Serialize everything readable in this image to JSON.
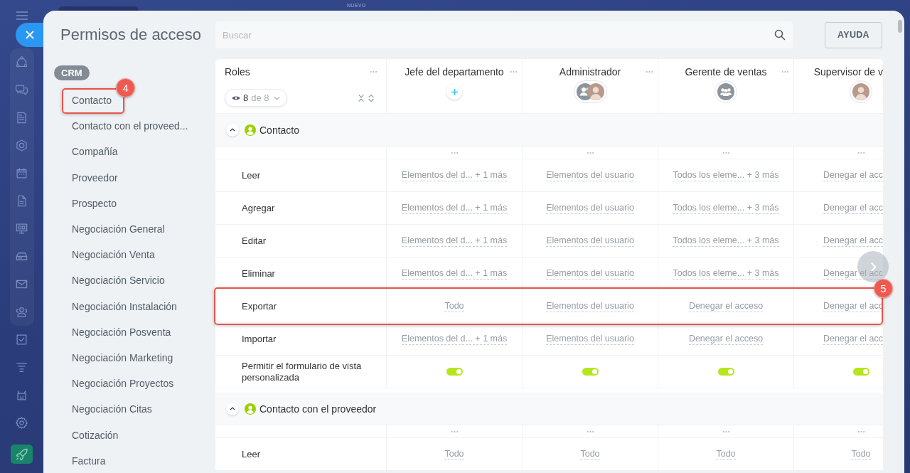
{
  "top_bar": {
    "badge": "NUEVO"
  },
  "panel": {
    "title": "Permisos de acceso",
    "search": {
      "placeholder": "Buscar"
    },
    "help_button": "AYUDA"
  },
  "nav": {
    "group": "CRM",
    "items": [
      {
        "label": "Contacto",
        "callout": "4"
      },
      {
        "label": "Contacto con el proveed..."
      },
      {
        "label": "Compañía"
      },
      {
        "label": "Proveedor"
      },
      {
        "label": "Prospecto"
      },
      {
        "label": "Negociación General"
      },
      {
        "label": "Negociación Venta"
      },
      {
        "label": "Negociación Servicio"
      },
      {
        "label": "Negociación Instalación"
      },
      {
        "label": "Negociación Posventa"
      },
      {
        "label": "Negociación Marketing"
      },
      {
        "label": "Negociación Proyectos"
      },
      {
        "label": "Negociación Citas"
      },
      {
        "label": "Cotización"
      },
      {
        "label": "Factura"
      }
    ]
  },
  "table": {
    "roles_header": "Roles",
    "filter": {
      "shown": "8",
      "total": "de 8"
    },
    "roles": [
      {
        "name": "Jefe del departamento",
        "members": [
          {
            "kind": "add"
          }
        ]
      },
      {
        "name": "Administrador",
        "members": [
          {
            "kind": "group"
          },
          {
            "kind": "user"
          }
        ]
      },
      {
        "name": "Gerente de ventas",
        "members": [
          {
            "kind": "department"
          }
        ]
      },
      {
        "name": "Supervisor de v",
        "members": [
          {
            "kind": "user"
          }
        ]
      }
    ],
    "sections": [
      {
        "title": "Contacto",
        "expanded": true,
        "rows": [
          {
            "label": "Leer",
            "kind": "select",
            "cells": [
              {
                "value": "Elementos del d... + 1 más"
              },
              {
                "value": "Elementos del usuario"
              },
              {
                "value": "Todos los eleme... + 3 más"
              },
              {
                "value": "Denegar el acc"
              }
            ]
          },
          {
            "label": "Agregar",
            "kind": "select",
            "cells": [
              {
                "value": "Elementos del d... + 1 más"
              },
              {
                "value": "Elementos del usuario"
              },
              {
                "value": "Todos los eleme... + 3 más"
              },
              {
                "value": "Denegar el acc"
              }
            ]
          },
          {
            "label": "Editar",
            "kind": "select",
            "cells": [
              {
                "value": "Elementos del d... + 1 más"
              },
              {
                "value": "Elementos del usuario"
              },
              {
                "value": "Todos los eleme... + 3 más"
              },
              {
                "value": "Denegar el acc"
              }
            ]
          },
          {
            "label": "Eliminar",
            "kind": "select",
            "cells": [
              {
                "value": "Elementos del d... + 1 más"
              },
              {
                "value": "Elementos del usuario"
              },
              {
                "value": "Todos los eleme... + 3 más"
              },
              {
                "value": "Denegar el acc"
              }
            ]
          },
          {
            "label": "Exportar",
            "kind": "select",
            "callout": "5",
            "cells": [
              {
                "value": "Todo"
              },
              {
                "value": "Elementos del usuario"
              },
              {
                "value": "Denegar el acceso"
              },
              {
                "value": "Denegar el acc"
              }
            ]
          },
          {
            "label": "Importar",
            "kind": "select",
            "cells": [
              {
                "value": "Elementos del d... + 1 más"
              },
              {
                "value": "Elementos del usuario"
              },
              {
                "value": "Denegar el acceso"
              },
              {
                "value": "Denegar el acc"
              }
            ]
          },
          {
            "label": "Permitir el formulario de vista personalizada",
            "kind": "toggle",
            "cells": [
              {
                "on": true
              },
              {
                "on": true
              },
              {
                "on": true
              },
              {
                "on": true
              }
            ]
          }
        ]
      },
      {
        "title": "Contacto con el proveedor",
        "expanded": true,
        "rows": [
          {
            "label": "Leer",
            "kind": "select",
            "cells": [
              {
                "value": "Todo"
              },
              {
                "value": "Todo"
              },
              {
                "value": "Todo"
              },
              {
                "value": "Todo"
              }
            ]
          }
        ]
      }
    ]
  }
}
